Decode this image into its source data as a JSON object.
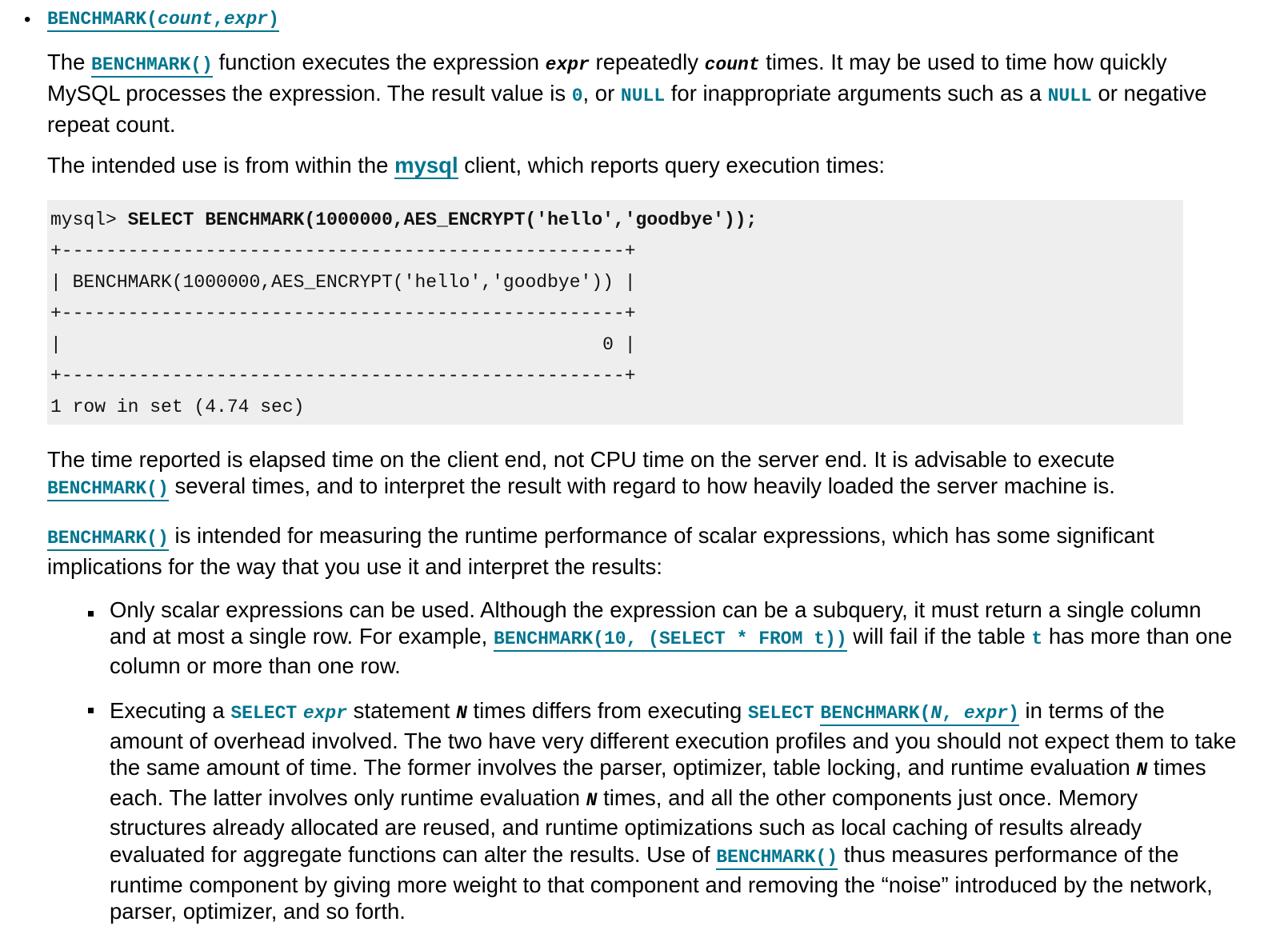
{
  "heading": {
    "func": "BENCHMARK(",
    "arg1": "count",
    "comma": ",",
    "arg2": "expr",
    "close": ")"
  },
  "p1": {
    "t1": "The ",
    "link": "BENCHMARK()",
    "t2": " function executes the expression ",
    "expr": "expr",
    "t3": " repeatedly ",
    "count": "count",
    "t4": " times. It may be used to time how quickly MySQL processes the expression. The result value is ",
    "zero": "0",
    "t5": ", or ",
    "null1": "NULL",
    "t6": " for inappropriate arguments such as a ",
    "null2": "NULL",
    "t7": " or negative repeat count."
  },
  "p2": {
    "t1": "The intended use is from within the ",
    "link": "mysql",
    "t2": " client, which reports query execution times:"
  },
  "code": {
    "prompt": "mysql> ",
    "stmt": "SELECT BENCHMARK(1000000,AES_ENCRYPT('hello','goodbye'));",
    "border1": "+---------------------------------------------------+",
    "header": "| BENCHMARK(1000000,AES_ENCRYPT('hello','goodbye')) |",
    "border2": "+---------------------------------------------------+",
    "row": "|                                                 0 |",
    "border3": "+---------------------------------------------------+",
    "footer": "1 row in set (4.74 sec)"
  },
  "p3": {
    "t1": "The time reported is elapsed time on the client end, not CPU time on the server end. It is advisable to execute ",
    "link": "BENCHMARK()",
    "t2": " several times, and to interpret the result with regard to how heavily loaded the server machine is."
  },
  "p4": {
    "link": "BENCHMARK()",
    "t1": " is intended for measuring the runtime performance of scalar expressions, which has some significant implications for the way that you use it and interpret the results:"
  },
  "li1": {
    "t1": "Only scalar expressions can be used. Although the expression can be a subquery, it must return a single column and at most a single row. For example, ",
    "link": "BENCHMARK(10, (SELECT * FROM t))",
    "t2": " will fail if the table ",
    "tbl": "t",
    "t3": " has more than one column or more than one row."
  },
  "li2": {
    "t1": "Executing a ",
    "select": "SELECT",
    "expr": "expr",
    "t2": " statement ",
    "n1": "N",
    "t3": " times differs from executing ",
    "select2": "SELECT",
    "link_a": "BENCHMARK(",
    "n2": "N",
    "link_b": ",",
    "expr2": "expr",
    "link_c": ")",
    "t4": " in terms of the amount of overhead involved. The two have very different execution profiles and you should not expect them to take the same amount of time. The former involves the parser, optimizer, table locking, and runtime evaluation ",
    "n3": "N",
    "t5": " times each. The latter involves only runtime evaluation ",
    "n4": "N",
    "t6": " times, and all the other components just once. Memory structures already allocated are reused, and runtime optimizations such as local caching of results already evaluated for aggregate functions can alter the results. Use of ",
    "link2": "BENCHMARK()",
    "t7": " thus measures performance of the runtime component by giving more weight to that component and removing the “noise” introduced by the network, parser, optimizer, and so forth."
  }
}
